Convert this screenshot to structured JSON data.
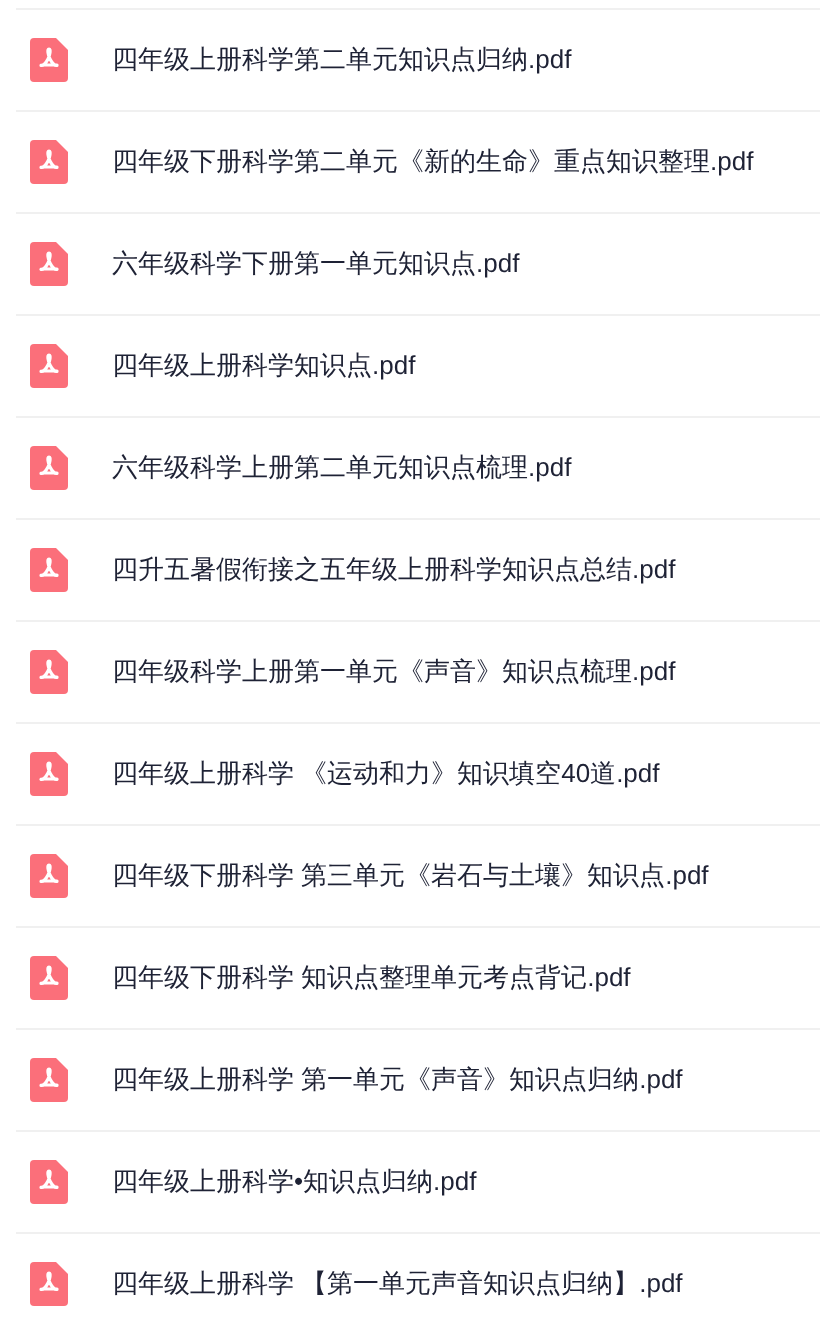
{
  "files": [
    {
      "name": "四年级上册科学第二单元知识点归纳.pdf"
    },
    {
      "name": "四年级下册科学第二单元《新的生命》重点知识整理.pdf"
    },
    {
      "name": "六年级科学下册第一单元知识点.pdf"
    },
    {
      "name": "四年级上册科学知识点.pdf"
    },
    {
      "name": "六年级科学上册第二单元知识点梳理.pdf"
    },
    {
      "name": "四升五暑假衔接之五年级上册科学知识点总结.pdf"
    },
    {
      "name": "四年级科学上册第一单元《声音》知识点梳理.pdf"
    },
    {
      "name": "四年级上册科学 《运动和力》知识填空40道.pdf"
    },
    {
      "name": "四年级下册科学 第三单元《岩石与土壤》知识点.pdf"
    },
    {
      "name": "四年级下册科学 知识点整理单元考点背记.pdf"
    },
    {
      "name": "四年级上册科学 第一单元《声音》知识点归纳.pdf"
    },
    {
      "name": "四年级上册科学•知识点归纳.pdf"
    },
    {
      "name": "四年级上册科学 【第一单元声音知识点归纳】.pdf"
    }
  ]
}
